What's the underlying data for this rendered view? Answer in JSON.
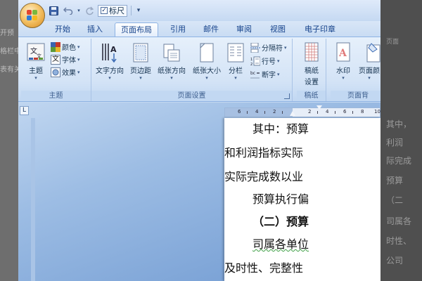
{
  "background": {
    "left_ghost": [
      "开预",
      "格栏中",
      "表有关"
    ],
    "right_ghost": [
      "页面",
      "其中，",
      "利润",
      "际完成",
      "预算",
      "（二",
      "司属各",
      "时性、",
      "公司"
    ]
  },
  "quick_access": {
    "ruler_checkbox_mark": "✓",
    "ruler_label": "标尺",
    "customize_arrow": "▾"
  },
  "tabs": [
    {
      "label": "开始"
    },
    {
      "label": "插入"
    },
    {
      "label": "页面布局"
    },
    {
      "label": "引用"
    },
    {
      "label": "邮件"
    },
    {
      "label": "审阅"
    },
    {
      "label": "视图"
    },
    {
      "label": "电子印章"
    }
  ],
  "ribbon": {
    "theme_group": {
      "label": "主题",
      "theme_button": "主题",
      "colors": "颜色",
      "fonts": "字体",
      "effects": "效果"
    },
    "page_setup_group": {
      "label": "页面设置",
      "text_direction": "文字方向",
      "margins": "页边距",
      "orientation": "纸张方向",
      "size": "纸张大小",
      "columns": "分栏",
      "breaks": "分隔符",
      "line_numbers": "行号",
      "hyphenation": "断字"
    },
    "manuscript_group": {
      "label": "稿纸",
      "button_line1": "稿纸",
      "button_line2": "设置"
    },
    "background_group": {
      "label": "页面背",
      "watermark": "水印",
      "page_color": "页面颜"
    }
  },
  "ruler": {
    "corner_symbol": "L",
    "numbers": [
      "6",
      "4",
      "2",
      "2",
      "4",
      "6",
      "8",
      "10"
    ]
  },
  "document": {
    "lines": [
      "其中：预算",
      "和利润指标实际",
      "实际完成数以业",
      "预算执行偏",
      "（二）预算",
      "司属各单位",
      "及时性、完整性"
    ]
  }
}
